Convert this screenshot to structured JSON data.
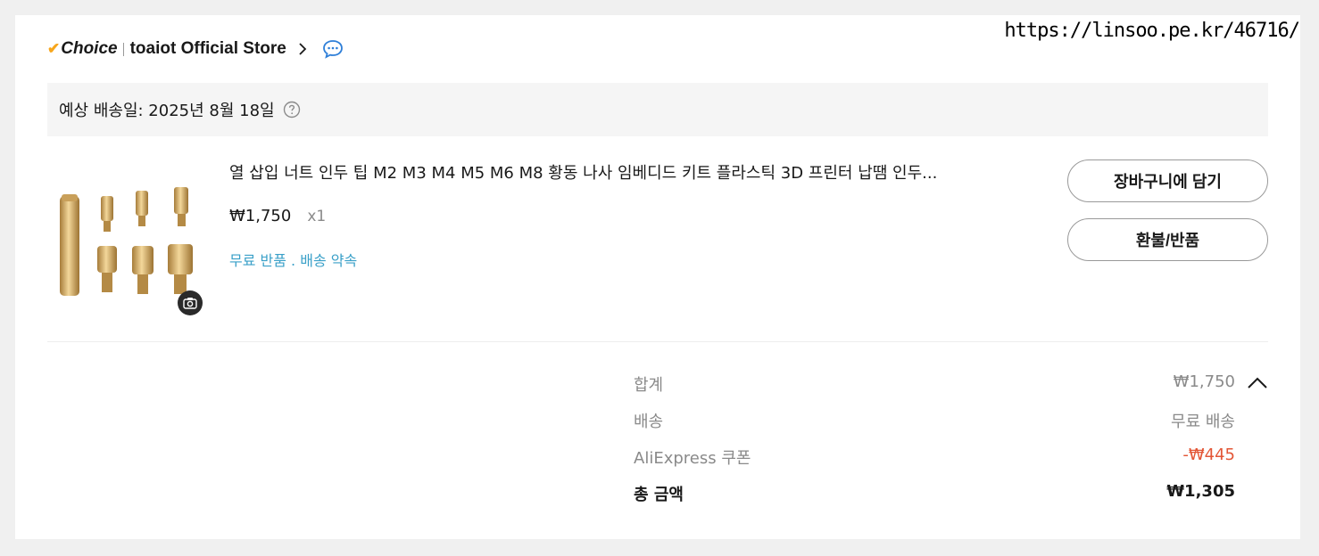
{
  "watermark": "https://linsoo.pe.kr/46716/",
  "store": {
    "choice_label": "Choice",
    "name": "toaiot Official Store"
  },
  "delivery": {
    "text": "예상 배송일: 2025년 8월 18일"
  },
  "item": {
    "title": "열 삽입 너트 인두 팁 M2 M3 M4 M5 M6 M8 황동 나사 임베디드 키트 플라스틱 3D 프린터 납땜 인두...",
    "price": "₩1,750",
    "quantity": "x1",
    "perks": "무료 반품 . 배송 약속"
  },
  "actions": {
    "add_to_cart": "장바구니에 담기",
    "refund_return": "환불/반품"
  },
  "summary": {
    "subtotal_label": "합계",
    "subtotal_value": "₩1,750",
    "shipping_label": "배송",
    "shipping_value": "무료 배송",
    "coupon_label": "AliExpress 쿠폰",
    "coupon_value": "-₩445",
    "total_label": "총 금액",
    "total_value": "₩1,305"
  },
  "colors": {
    "choice_check": "#f7a61c",
    "chat_icon": "#2f7fd8",
    "perks_text": "#3aa0c8",
    "coupon_red": "#e35636"
  },
  "icons": [
    "check-icon",
    "chevron-right-icon",
    "chat-bubble-icon",
    "help-circle-icon",
    "camera-icon",
    "chevron-up-icon"
  ]
}
